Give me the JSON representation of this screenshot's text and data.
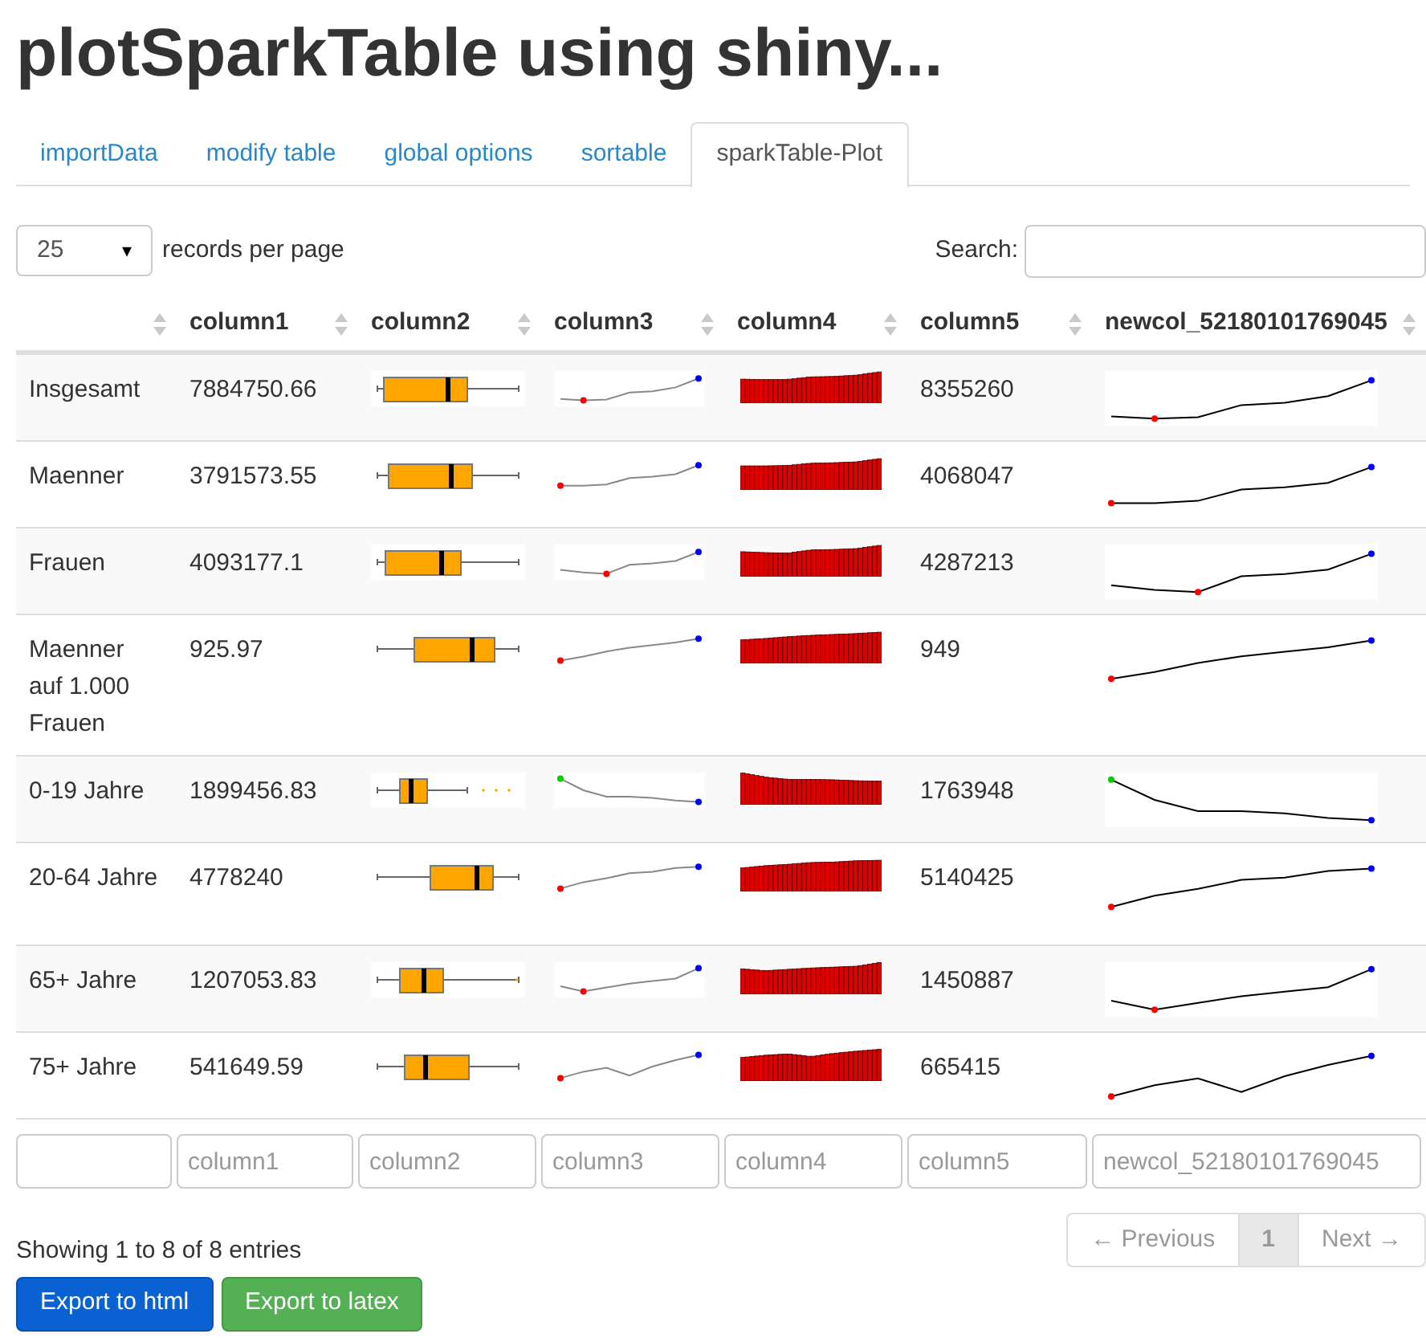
{
  "title": "plotSparkTable using shiny...",
  "tabs": [
    {
      "label": "importData",
      "selected": false
    },
    {
      "label": "modify table",
      "selected": false
    },
    {
      "label": "global options",
      "selected": false
    },
    {
      "label": "sortable",
      "selected": false
    },
    {
      "label": "sparkTable-Plot",
      "selected": true
    }
  ],
  "length_select": {
    "value": "25",
    "caret": "▾"
  },
  "length_label": "records per page",
  "search": {
    "label": "Search:"
  },
  "table": {
    "columns": [
      "column1",
      "column2",
      "column3",
      "column4",
      "column5",
      "newcol_52180101769045"
    ],
    "rows": [
      {
        "label": "Insgesamt",
        "column1": "7884750.66",
        "column5": "8355260"
      },
      {
        "label": "Maenner",
        "column1": "3791573.55",
        "column5": "4068047"
      },
      {
        "label": "Frauen",
        "column1": "4093177.1",
        "column5": "4287213"
      },
      {
        "label": "Maenner auf 1.000 Frauen",
        "column1": "925.97",
        "column5": "949"
      },
      {
        "label": "0-19 Jahre",
        "column1": "1899456.83",
        "column5": "1763948"
      },
      {
        "label": "20-64 Jahre",
        "column1": "4778240",
        "column5": "5140425"
      },
      {
        "label": "65+ Jahre",
        "column1": "1207053.83",
        "column5": "1450887"
      },
      {
        "label": "75+ Jahre",
        "column1": "541649.59",
        "column5": "665415"
      }
    ],
    "filters": [
      {
        "placeholder": "column1"
      },
      {
        "placeholder": "column2"
      },
      {
        "placeholder": "column3"
      },
      {
        "placeholder": "column4"
      },
      {
        "placeholder": "column5"
      },
      {
        "placeholder": "newcol_52180101769045"
      }
    ]
  },
  "info": "Showing 1 to 8 of 8 entries",
  "pagination": [
    {
      "label": "← Previous",
      "disabled": true,
      "selected": false
    },
    {
      "label": "1",
      "disabled": false,
      "selected": true
    },
    {
      "label": "Next →",
      "disabled": true,
      "selected": false
    }
  ],
  "buttons": [
    {
      "label": "Export to html",
      "kind": "primary"
    },
    {
      "label": "Export to latex",
      "kind": "success"
    }
  ]
}
